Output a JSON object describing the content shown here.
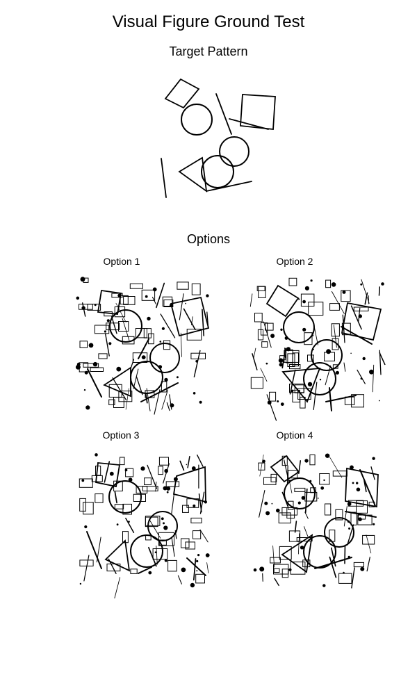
{
  "title": "Visual Figure Ground Test",
  "target_label": "Target Pattern",
  "options_label": "Options",
  "options": [
    {
      "label": "Option 1"
    },
    {
      "label": "Option 2"
    },
    {
      "label": "Option 3"
    },
    {
      "label": "Option 4"
    }
  ]
}
